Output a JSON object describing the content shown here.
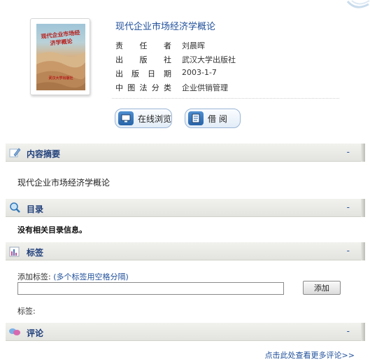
{
  "book": {
    "title": "现代企业市场经济学概论",
    "cover": {
      "title_text": "现代企业市场经济学概论",
      "publisher_text": "武汉大学出版社"
    },
    "info": [
      {
        "label": "责任者",
        "value": "刘晨晖"
      },
      {
        "label": "出版社",
        "value": "武汉大学出版社"
      },
      {
        "label": "出版日期",
        "value": "2003-1-7"
      },
      {
        "label": "中图法分类",
        "value": "企业供销管理"
      }
    ]
  },
  "actions": {
    "browse_online": "在线浏览",
    "borrow": "借 阅"
  },
  "sections": {
    "summary": {
      "title": "内容摘要",
      "toggle": "-",
      "content": "现代企业市场经济学概论"
    },
    "toc": {
      "title": "目录",
      "toggle": "-",
      "content": "没有相关目录信息。"
    },
    "tags": {
      "title": "标签",
      "toggle": "-",
      "add_prompt": "添加标签:",
      "add_hint": "(多个标签用空格分隔)",
      "input_value": "",
      "add_button": "添加",
      "tags_label": "标签:"
    },
    "comments": {
      "title": "评论",
      "toggle": "-",
      "more_link": "点击此处查看更多评论>>"
    }
  },
  "colors": {
    "link": "#1f4f9a",
    "section_title": "#1f3f7a",
    "header_bg": "#e8e8e4"
  },
  "icons": [
    "book-cover-image",
    "monitor-icon",
    "document-icon",
    "pencil-icon",
    "magnifier-icon",
    "tag-chart-icon",
    "chat-bubbles-icon"
  ]
}
